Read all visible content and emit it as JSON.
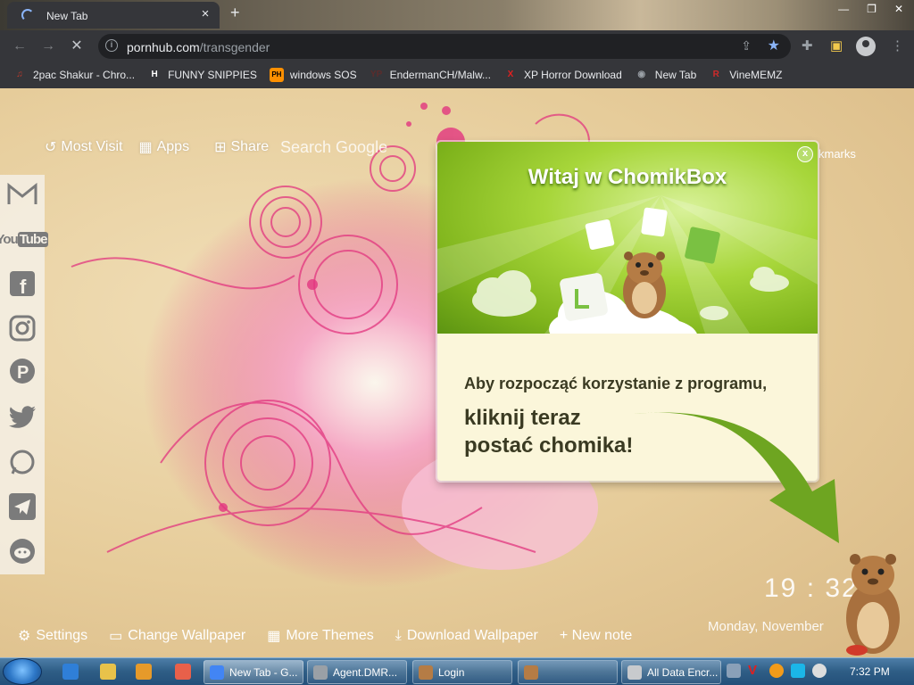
{
  "browser": {
    "tab": {
      "title": "New Tab",
      "close": "×",
      "new_tab": "+"
    },
    "window_buttons": {
      "minimize": "—",
      "maximize": "❐",
      "close": "✕"
    },
    "url": {
      "domain": "pornhub.com",
      "path": "/transgender"
    },
    "bookmarks": [
      {
        "label": "2pac Shakur - Chro...",
        "icon": "2pac-icon",
        "color": "#c0392b",
        "glyph": "♫"
      },
      {
        "label": "FUNNY SNIPPIES",
        "icon": "history-h-icon",
        "color": "#ffffff",
        "glyph": "H"
      },
      {
        "label": "windows SOS",
        "icon": "ph-icon",
        "color": "#ff9000",
        "glyph": "PH"
      },
      {
        "label": "EndermanCH/Malw...",
        "icon": "yp-icon",
        "color": "#5b2c2c",
        "glyph": "YP"
      },
      {
        "label": "XP Horror Download",
        "icon": "x-icon",
        "color": "#e02020",
        "glyph": "X"
      },
      {
        "label": "New Tab",
        "icon": "chrome-icon",
        "color": "#9aa0a6",
        "glyph": "◉"
      },
      {
        "label": "VineMEMZ",
        "icon": "r-icon",
        "color": "#d12a2a",
        "glyph": "R"
      }
    ]
  },
  "newtab": {
    "topbar": {
      "most_visited": "Most Visit",
      "apps": "Apps",
      "share": "Share"
    },
    "search_placeholder": "Search Google",
    "bookmarks_link": "kmarks",
    "bottom": {
      "settings": "Settings",
      "change_wallpaper": "Change Wallpaper",
      "more_themes": "More Themes",
      "download_wallpaper": "Download Wallpaper",
      "new_note": "+ New note"
    },
    "clock": "19 : 32",
    "date": "Monday, November"
  },
  "popup": {
    "title": "Witaj w ChomikBox",
    "close": "x",
    "line1": "Aby rozpocząć korzystanie z programu,",
    "line2": "kliknij teraz postać chomika!"
  },
  "taskbar": {
    "tasks": [
      {
        "label": "New Tab - G...",
        "active": true
      },
      {
        "label": "Agent.DMR...",
        "active": false
      },
      {
        "label": "Login",
        "active": false
      },
      {
        "label": "",
        "active": false
      },
      {
        "label": "All Data Encr...",
        "active": false
      }
    ],
    "time": "7:32 PM"
  },
  "colors": {
    "chrome_dark": "#35363a",
    "accent_blue": "#8ab4f8",
    "popup_green": "#7fb41c",
    "pink": "#e83a8e"
  }
}
